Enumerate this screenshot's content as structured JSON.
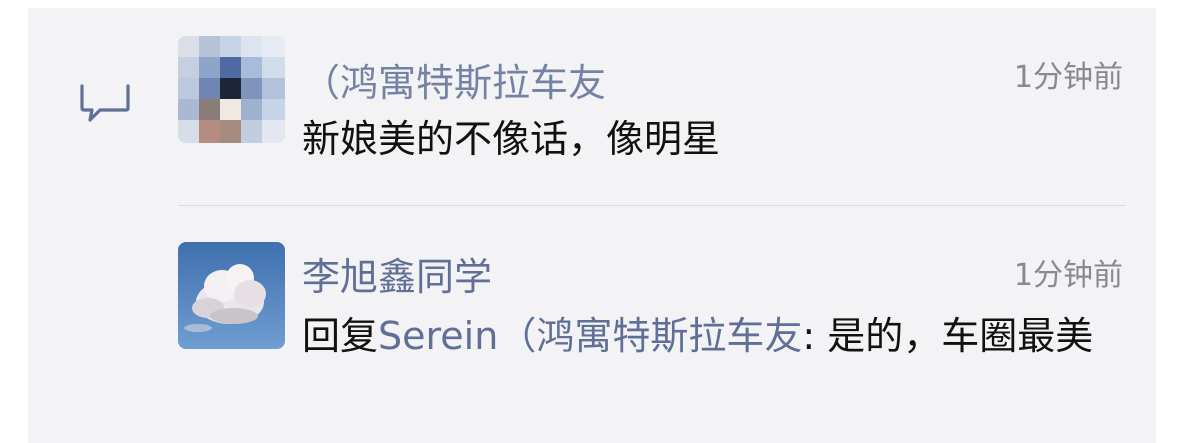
{
  "icons": {
    "comment": "comment-bubble-icon",
    "avatar_pixelated": "pixelated-avatar",
    "avatar_cloud": "cloud-sky-avatar"
  },
  "colors": {
    "panel_bg": "#f3f3f5",
    "name": "#5f6f96",
    "time": "#8a8a8e",
    "text": "#111111"
  },
  "comments": [
    {
      "name": "（鸿寓特斯拉车友",
      "time": "1分钟前",
      "text": "新娘美的不像话，像明星"
    },
    {
      "name": "李旭鑫同学",
      "time": "1分钟前",
      "reply_prefix": "回复",
      "reply_to": "Serein（鸿寓特斯拉车友",
      "reply_separator": ":",
      "reply_text": " 是的，车圈最美"
    }
  ]
}
